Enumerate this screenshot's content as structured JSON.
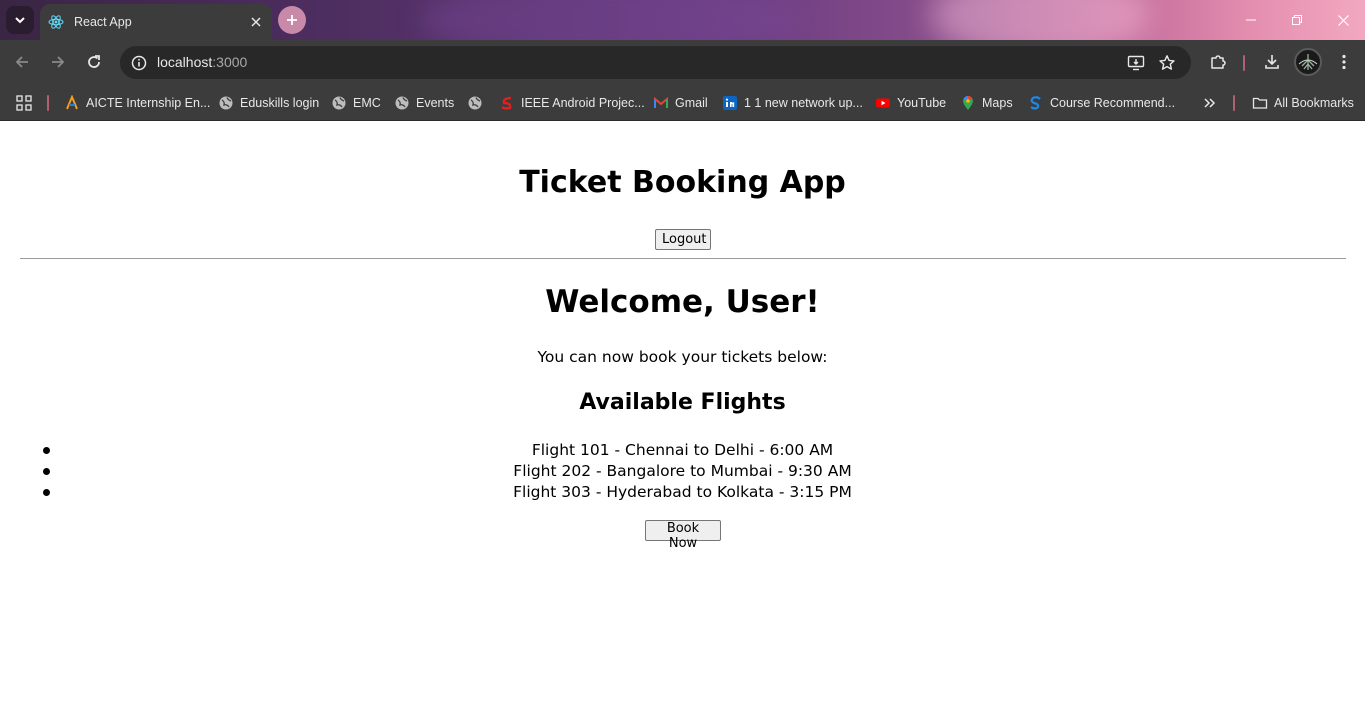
{
  "browser": {
    "tab_title": "React App",
    "url_host": "localhost",
    "url_port": ":3000",
    "bookmarks": [
      {
        "label": "AICTE Internship En...",
        "icon": "aicte-icon"
      },
      {
        "label": "Eduskills login",
        "icon": "globe-icon"
      },
      {
        "label": "EMC",
        "icon": "globe-icon"
      },
      {
        "label": "Events",
        "icon": "globe-icon"
      },
      {
        "label": "",
        "icon": "globe-icon"
      },
      {
        "label": "IEEE Android Projec...",
        "icon": "ieee-icon"
      },
      {
        "label": "Gmail",
        "icon": "gmail-icon"
      },
      {
        "label": "1 1 new network up...",
        "icon": "linkedin-icon"
      },
      {
        "label": "YouTube",
        "icon": "youtube-icon"
      },
      {
        "label": "Maps",
        "icon": "maps-icon"
      },
      {
        "label": "Course Recommend...",
        "icon": "course-icon"
      }
    ],
    "all_bookmarks_label": "All Bookmarks"
  },
  "app": {
    "title": "Ticket Booking App",
    "logout_label": "Logout",
    "welcome": "Welcome, User!",
    "subtitle": "You can now book your tickets below:",
    "flights_heading": "Available Flights",
    "flights": [
      "Flight 101 - Chennai to Delhi - 6:00 AM",
      "Flight 202 - Bangalore to Mumbai - 9:30 AM",
      "Flight 303 - Hyderabad to Kolkata - 3:15 PM"
    ],
    "book_label": "Book Now"
  }
}
